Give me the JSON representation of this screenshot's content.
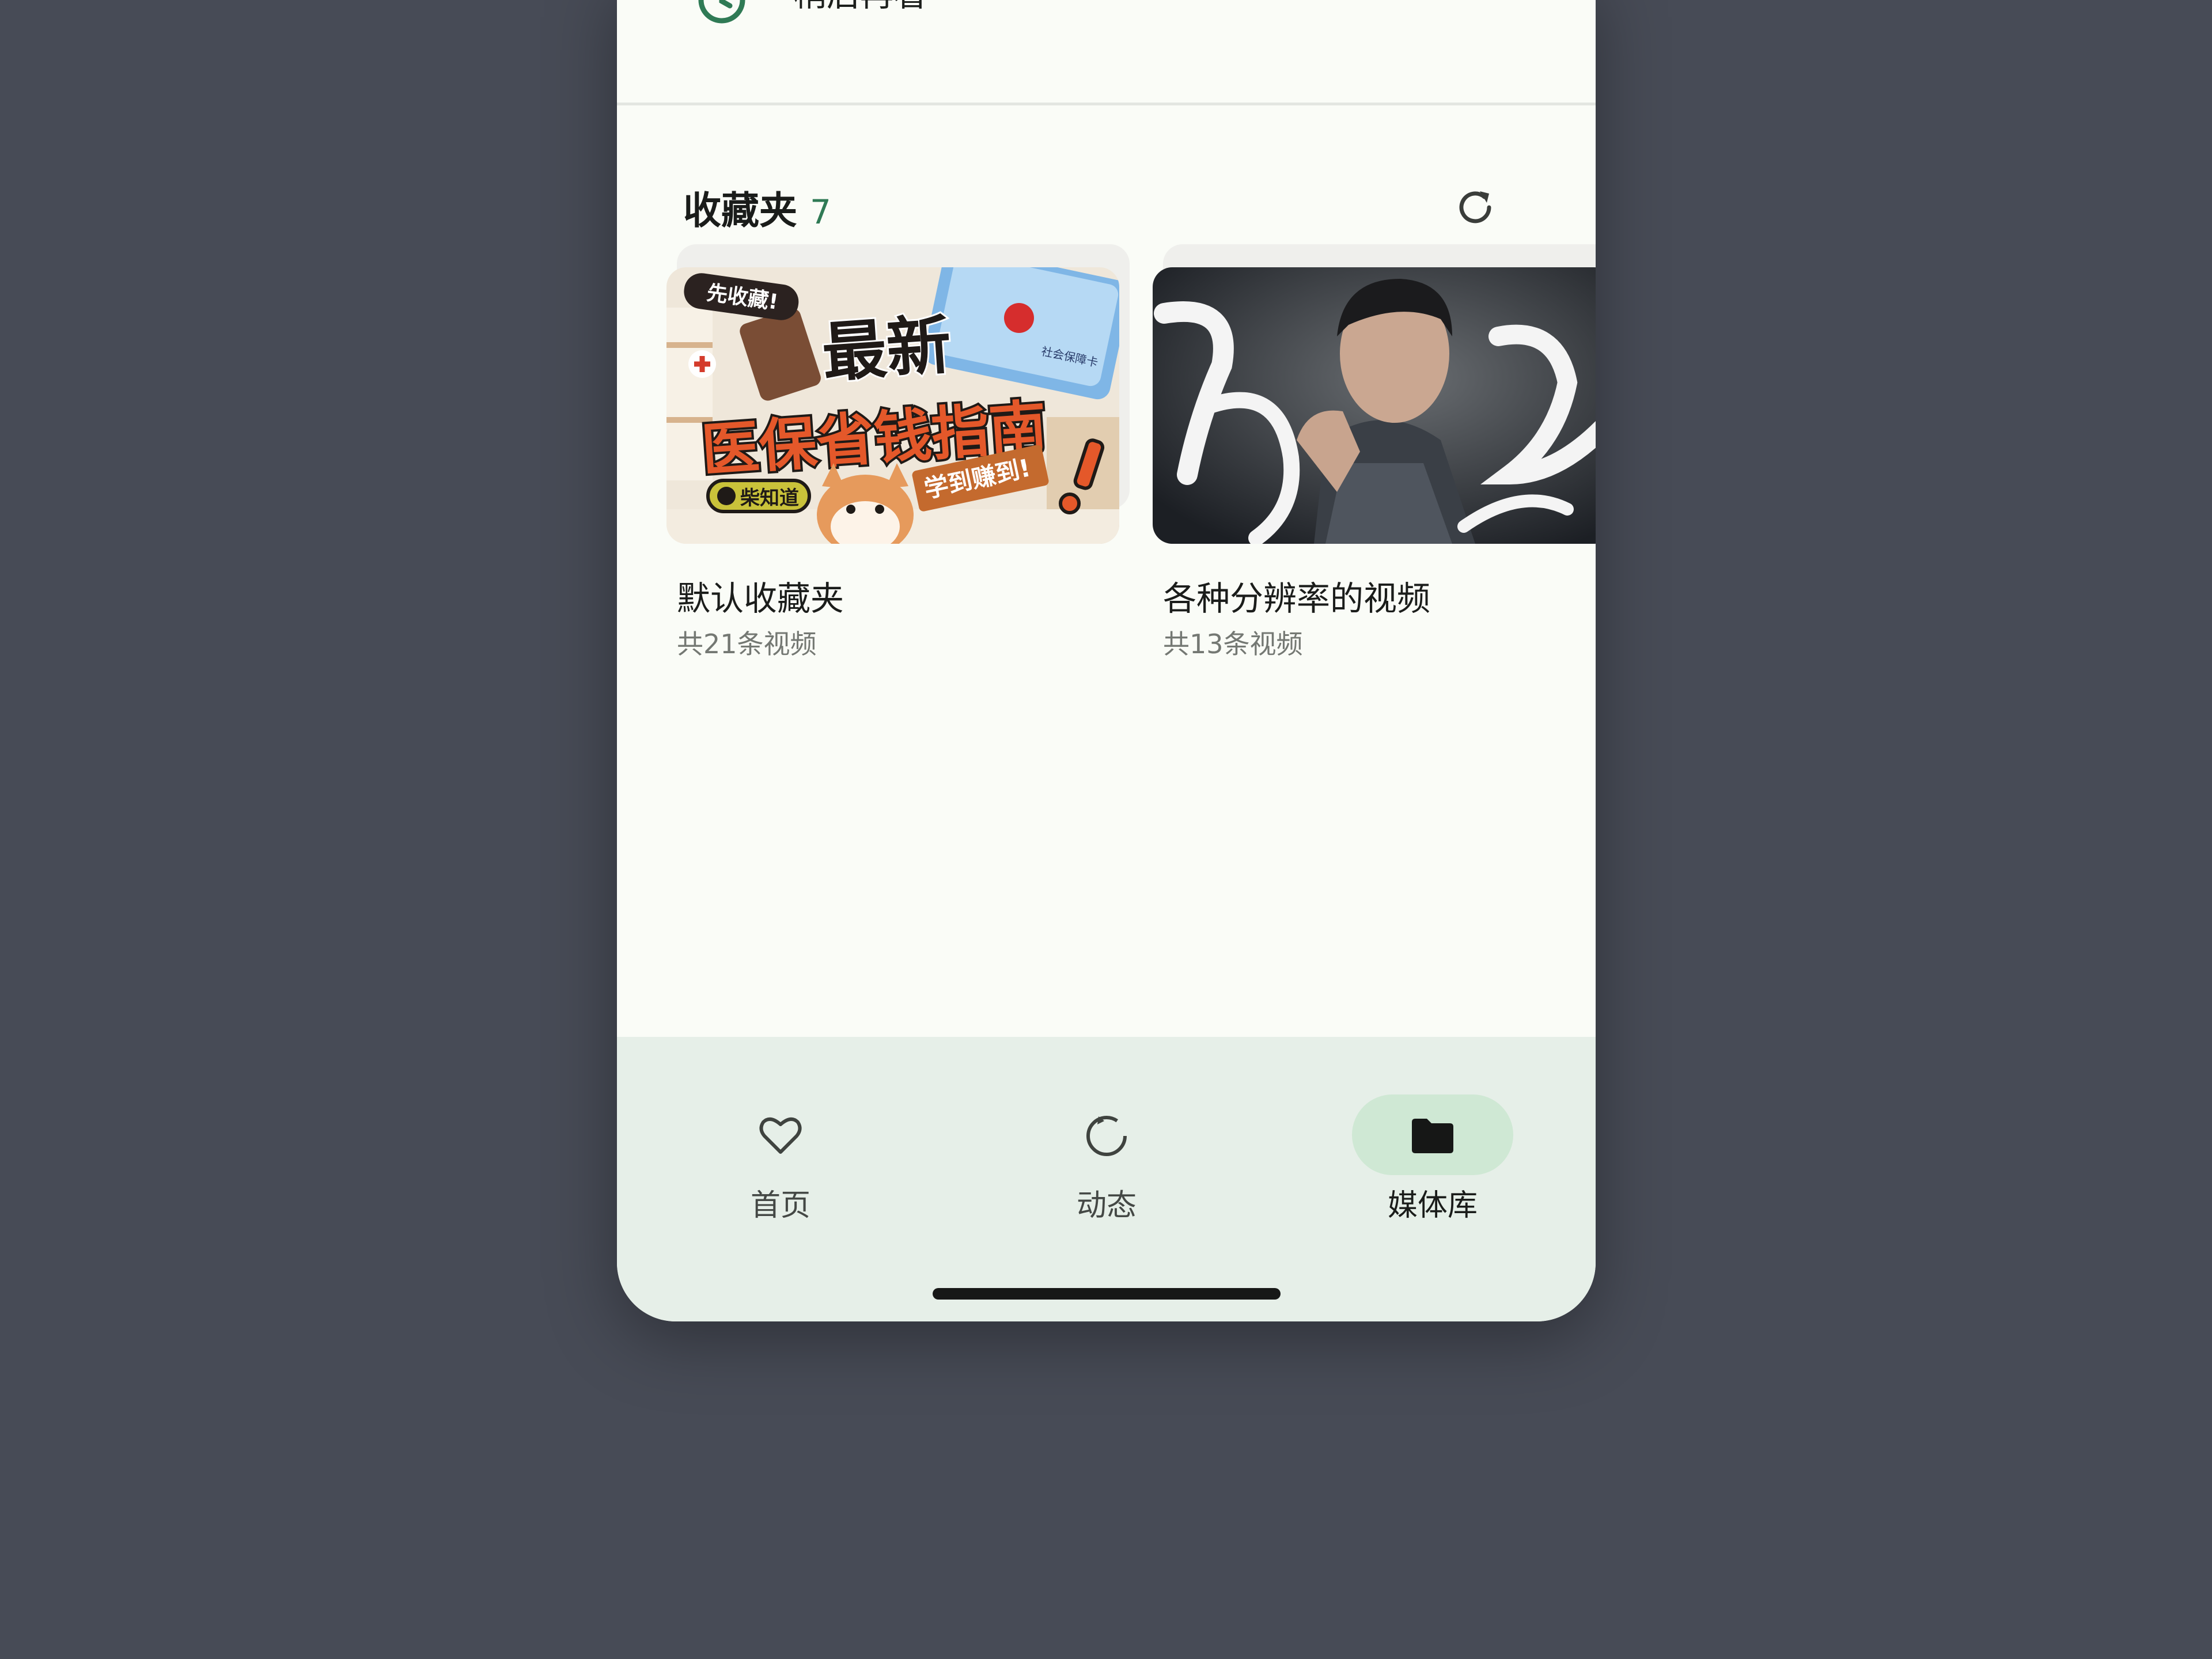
{
  "top_item": {
    "label": "稍后再看",
    "icon": "clock-icon"
  },
  "favorites": {
    "title": "收藏夹",
    "count": "7",
    "refresh_icon": "refresh-icon",
    "folders": [
      {
        "name": "默认收藏夹",
        "subtitle": "共21条视频",
        "thumb_text": {
          "tag": "先收藏!",
          "line1": "最新",
          "line2": "医保省钱指南",
          "badge": "学到赚到!",
          "brand": "柴知道",
          "card": "社会保障卡"
        }
      },
      {
        "name": "各种分辨率的视频",
        "subtitle": "共13条视频"
      }
    ]
  },
  "bottom_nav": {
    "items": [
      {
        "label": "首页",
        "icon": "heart-icon",
        "active": false
      },
      {
        "label": "动态",
        "icon": "refresh-circle-icon",
        "active": false
      },
      {
        "label": "媒体库",
        "icon": "folder-icon",
        "active": true
      }
    ]
  },
  "colors": {
    "accent": "#2f7a55",
    "nav_bg": "#e6efe8",
    "nav_active_pill": "#cfe8d4",
    "page_bg": "#474b56"
  }
}
